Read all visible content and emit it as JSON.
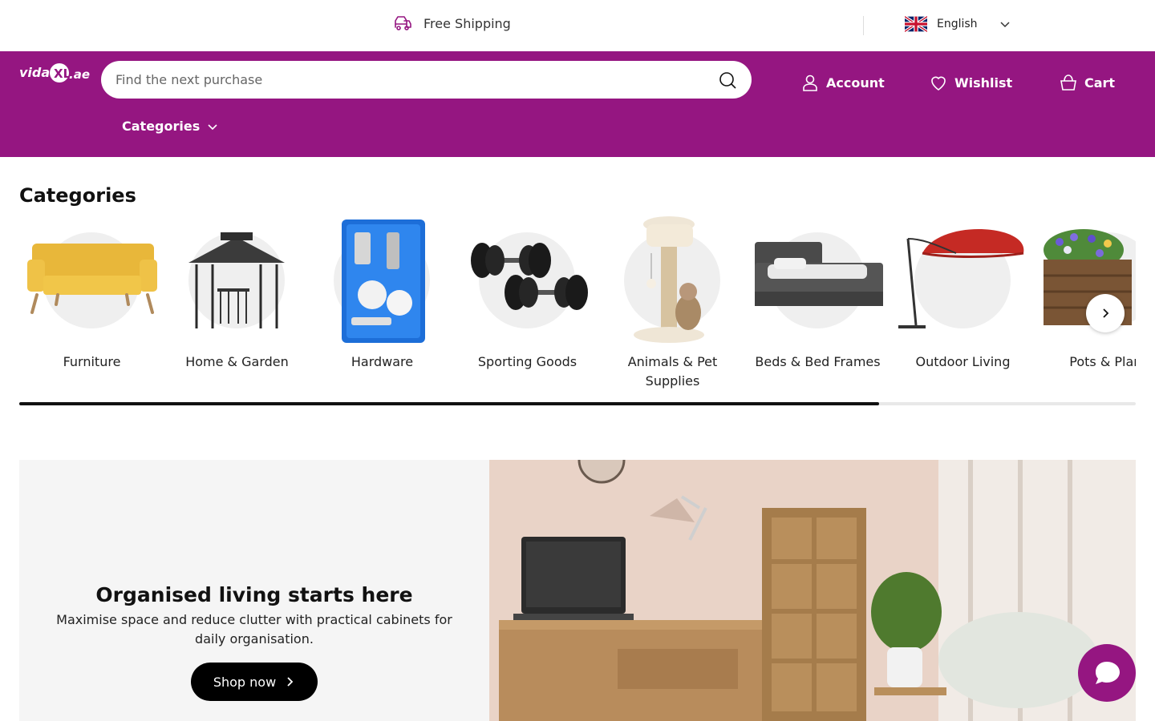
{
  "topbar": {
    "shipping_text": "Free Shipping",
    "language": "English"
  },
  "header": {
    "logo_text": "vidaXL.ae",
    "search_placeholder": "Find the next purchase",
    "account_label": "Account",
    "wishlist_label": "Wishlist",
    "cart_label": "Cart",
    "categories_toggle": "Categories"
  },
  "categories": {
    "title": "Categories",
    "items": [
      {
        "label": "Furniture",
        "icon": "sofa"
      },
      {
        "label": "Home & Garden",
        "icon": "gazebo"
      },
      {
        "label": "Hardware",
        "icon": "tool-case"
      },
      {
        "label": "Sporting Goods",
        "icon": "dumbbells"
      },
      {
        "label": "Animals & Pet Supplies",
        "icon": "cat-tree"
      },
      {
        "label": "Beds & Bed Frames",
        "icon": "bed"
      },
      {
        "label": "Outdoor Living",
        "icon": "parasol"
      },
      {
        "label": "Pots & Plant",
        "icon": "planter"
      }
    ],
    "scroll_progress": 0.77
  },
  "banner": {
    "title": "Organised living starts here",
    "text": "Maximise space and reduce clutter with practical cabinets for daily organisation.",
    "button_label": "Shop now"
  },
  "colors": {
    "brand": "#951681",
    "button": "#000000"
  }
}
